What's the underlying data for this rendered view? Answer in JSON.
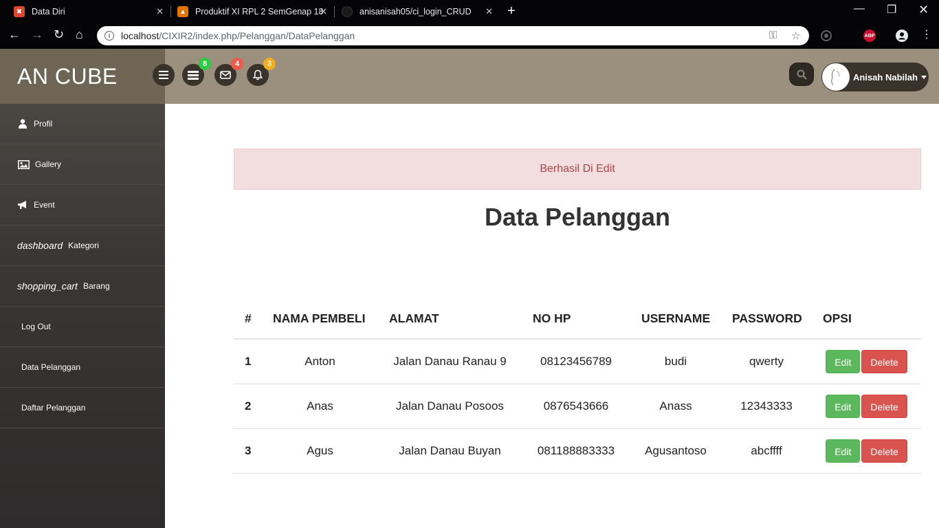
{
  "browser": {
    "tabs": [
      {
        "title": "Data Diri",
        "icon": "xampp-icon",
        "color": "#e0452f"
      },
      {
        "title": "Produktif XI RPL 2 SemGenap 18",
        "icon": "classroom-icon",
        "color": "#e37400"
      },
      {
        "title": "anisanisah05/ci_login_CRUD",
        "icon": "github-icon",
        "color": "#222222"
      }
    ],
    "url_host": "localhost",
    "url_path": "/CIXIR2/index.php/Pelanggan/DataPelanggan",
    "extension_label": "ABP"
  },
  "header": {
    "brand": "AN CUBE",
    "badges": {
      "tasks": "8",
      "messages": "4",
      "notifications": "3"
    },
    "badge_colors": {
      "tasks": "#2ecc40",
      "messages": "#f05a4a",
      "notifications": "#f0ad1e"
    },
    "user_name": "Anisah Nabilah"
  },
  "sidebar": {
    "items": [
      {
        "label": "Profil",
        "icon": "user-icon"
      },
      {
        "label": "Gallery",
        "icon": "image-icon"
      },
      {
        "label": "Event",
        "icon": "bullhorn-icon"
      },
      {
        "label": "Kategori",
        "ligature": "dashboard"
      },
      {
        "label": "Barang",
        "ligature": "shopping_cart"
      },
      {
        "label": "Log Out"
      },
      {
        "label": "Data Pelanggan"
      },
      {
        "label": "Daftar Pelanggan"
      }
    ]
  },
  "main": {
    "alert": "Berhasil Di Edit",
    "title": "Data Pelanggan",
    "table": {
      "headers": [
        "#",
        "NAMA PEMBELI",
        "ALAMAT",
        "NO HP",
        "USERNAME",
        "PASSWORD",
        "OPSI"
      ],
      "rows": [
        {
          "no": "1",
          "nama": "Anton",
          "alamat": "Jalan Danau Ranau 9",
          "hp": "08123456789",
          "username": "budi",
          "password": "qwerty"
        },
        {
          "no": "2",
          "nama": "Anas",
          "alamat": "Jalan Danau Posoos",
          "hp": "0876543666",
          "username": "Anass",
          "password": "12343333"
        },
        {
          "no": "3",
          "nama": "Agus",
          "alamat": "Jalan Danau Buyan",
          "hp": "081188883333",
          "username": "Agusantoso",
          "password": "abcffff"
        }
      ],
      "edit_label": "Edit",
      "delete_label": "Delete"
    }
  }
}
